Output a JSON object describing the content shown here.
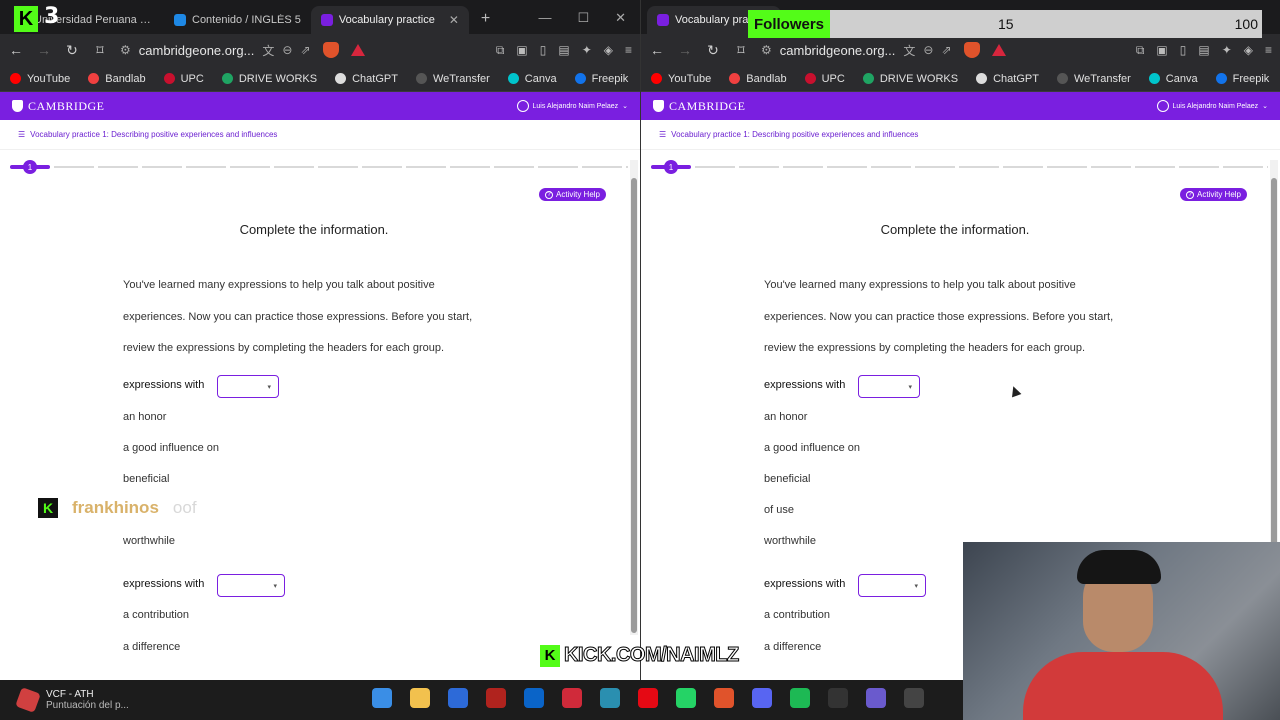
{
  "left": {
    "tabs": [
      {
        "label": "Universidad Peruana de C",
        "color": "#c8102e",
        "active": false
      },
      {
        "label": "Contenido / INGLÉS 5",
        "color": "#1e88e5",
        "active": false
      },
      {
        "label": "Vocabulary practice",
        "color": "#7a1fe0",
        "active": true
      }
    ],
    "new_tab": "+",
    "url": "cambridgeone.org..."
  },
  "right": {
    "tabs": [
      {
        "label": "Vocabulary practice",
        "color": "#7a1fe0",
        "active": true
      }
    ],
    "url": "cambridgeone.org..."
  },
  "bookmarks": [
    {
      "label": "YouTube",
      "color": "#ff0000"
    },
    {
      "label": "Bandlab",
      "color": "#f04040"
    },
    {
      "label": "UPC",
      "color": "#c8102e"
    },
    {
      "label": "DRIVE WORKS",
      "color": "#1fa463"
    },
    {
      "label": "ChatGPT",
      "color": "#dddddd"
    },
    {
      "label": "WeTransfer",
      "color": "#333333"
    },
    {
      "label": "Canva",
      "color": "#00c4cc"
    },
    {
      "label": "Freepik",
      "color": "#1273eb"
    }
  ],
  "cambridge": {
    "brand": "CAMBRIDGE",
    "user": "Luis Alejandro Naim Pelaez",
    "breadcrumb": "Vocabulary practice 1: Describing positive experiences and influences",
    "step": "1",
    "help_label": "Activity Help",
    "title": "Complete the information.",
    "paragraph_lines": [
      "You've learned many expressions to help you talk about positive",
      "experiences. Now you can practice those expressions. Before you start,",
      "review the expressions by completing the headers for each group."
    ],
    "group_label": "expressions with",
    "group1_items": [
      "an honor",
      "a good influence on",
      "beneficial",
      "of use",
      "worthwhile"
    ],
    "group2_items": [
      "a contribution",
      "a difference"
    ]
  },
  "overlay": {
    "followers_label": "Followers",
    "followers_count": "15",
    "followers_goal": "100",
    "chat_name": "frankhinos",
    "chat_message": "oof",
    "kick_url": "KICK.COM/NAIMLZ",
    "logo_number": "3",
    "logo_letter": "K"
  },
  "taskbar": {
    "weather_title": "VCF - ATH",
    "weather_sub": "Puntuación del p..."
  },
  "colors": {
    "accent": "#7a1fe0",
    "kick_green": "#53fc18"
  }
}
